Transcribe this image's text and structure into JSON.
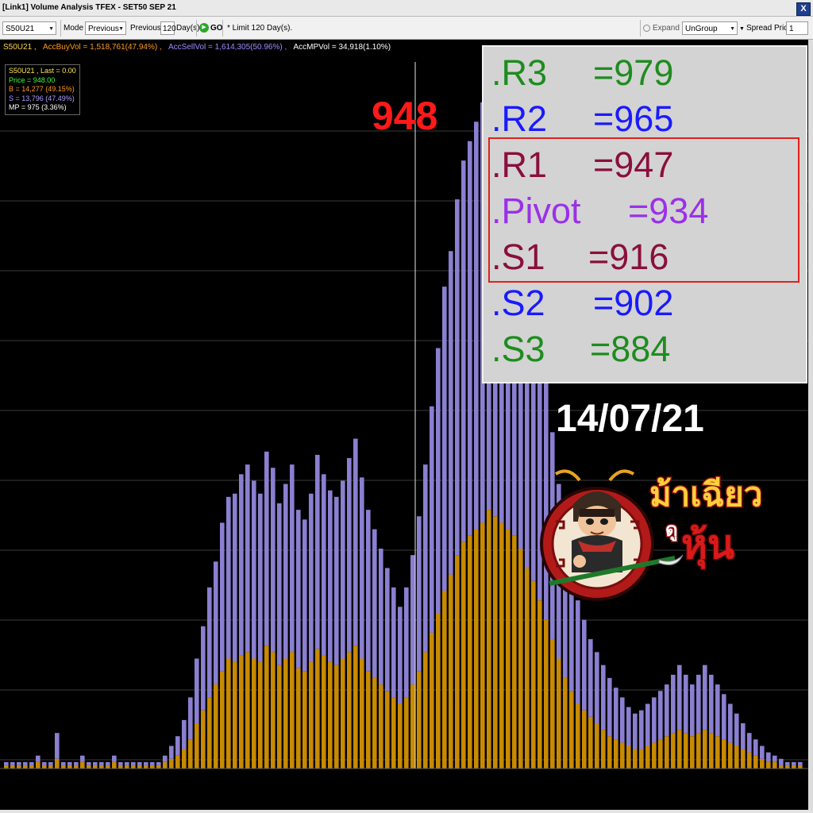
{
  "window": {
    "title": "[Link1] Volume Analysis TFEX - SET50 SEP 21",
    "close_label": "X"
  },
  "toolbar": {
    "symbol": "S50U21",
    "mode_label": "Mode :",
    "mode_value": "Previous",
    "previous_label": "Previous :",
    "previous_value": "120",
    "days_label": "Day(s)",
    "go_label": "GO",
    "limit_note": "* Limit 120 Day(s).",
    "expand_label": "Expand",
    "group_value": "UnGroup",
    "spread_label": "Spread Price :",
    "spread_value": "1"
  },
  "summary": {
    "symbol_text": "S50U21 ,",
    "acc_buy": "AccBuyVol = 1,518,761(47.94%) ,",
    "acc_sell": "AccSellVol = 1,614,305(50.96%) ,",
    "acc_mp": "AccMPVol = 34,918(1.10%)"
  },
  "infobox": {
    "line1": "S50U21 , Last = 0.00",
    "line2": "Price = 948.00",
    "line3": "B = 14,277 (49.15%)",
    "line4": "S = 13,796 (47.49%)",
    "line5": "MP = 975 (3.36%)"
  },
  "overlay": {
    "price_callout": "948",
    "date": "14/07/21",
    "levels": [
      {
        "name": ".R3",
        "value": "=979",
        "color": "#1e8c1e"
      },
      {
        "name": ".R2",
        "value": "=965",
        "color": "#1a1aff"
      },
      {
        "name": ".R1",
        "value": "=947",
        "color": "#8a0f3c"
      },
      {
        "name": ".Pivot",
        "value": "=934",
        "color": "#9b30e8"
      },
      {
        "name": ".S1",
        "value": "=916",
        "color": "#8a0f3c"
      },
      {
        "name": ".S2",
        "value": "=902",
        "color": "#1a1aff"
      },
      {
        "name": ".S3",
        "value": "=884",
        "color": "#1e8c1e"
      }
    ],
    "logo_text_top": "ม้าเฉียว",
    "logo_text_sub": "ดู",
    "logo_text_bottom": "หุ้น"
  },
  "colors": {
    "buy": "#c88a00",
    "sell": "#8a7fd0",
    "summary_symbol": "#ffd54a",
    "summary_buy": "#ff9a1e",
    "summary_sell": "#9d8cff",
    "summary_mp": "#ffffff"
  },
  "chart_data": {
    "type": "bar",
    "stacked": true,
    "series": [
      {
        "name": "B",
        "values": [
          1,
          1,
          1,
          1,
          1,
          2,
          1,
          1,
          3,
          1,
          1,
          1,
          2,
          1,
          1,
          1,
          1,
          2,
          1,
          1,
          1,
          1,
          1,
          1,
          1,
          2,
          3,
          4,
          6,
          9,
          14,
          18,
          22,
          26,
          30,
          34,
          33,
          35,
          36,
          34,
          33,
          38,
          36,
          32,
          34,
          36,
          31,
          30,
          33,
          37,
          35,
          33,
          32,
          34,
          36,
          38,
          34,
          30,
          28,
          26,
          24,
          22,
          20,
          22,
          26,
          30,
          36,
          42,
          48,
          55,
          60,
          66,
          70,
          72,
          74,
          76,
          80,
          78,
          76,
          74,
          72,
          68,
          62,
          58,
          52,
          46,
          40,
          34,
          28,
          24,
          20,
          18,
          16,
          14,
          12,
          10,
          9,
          8,
          7,
          6,
          6,
          7,
          8,
          9,
          10,
          11,
          12,
          11,
          10,
          11,
          12,
          11,
          10,
          9,
          8,
          7,
          6,
          5,
          4,
          3,
          2,
          2,
          1,
          1,
          1,
          1
        ]
      },
      {
        "name": "S",
        "values": [
          1,
          1,
          1,
          1,
          1,
          2,
          1,
          1,
          8,
          1,
          1,
          1,
          2,
          1,
          1,
          1,
          1,
          2,
          1,
          1,
          1,
          1,
          1,
          1,
          1,
          2,
          4,
          6,
          9,
          13,
          20,
          26,
          34,
          38,
          46,
          50,
          52,
          56,
          58,
          55,
          52,
          60,
          57,
          50,
          54,
          58,
          49,
          47,
          52,
          60,
          56,
          53,
          52,
          55,
          60,
          64,
          56,
          50,
          46,
          42,
          38,
          34,
          30,
          34,
          40,
          48,
          58,
          70,
          82,
          94,
          100,
          110,
          118,
          122,
          126,
          130,
          138,
          132,
          126,
          122,
          118,
          112,
          102,
          94,
          84,
          74,
          64,
          54,
          44,
          38,
          32,
          28,
          24,
          22,
          20,
          18,
          16,
          14,
          12,
          11,
          12,
          13,
          14,
          15,
          16,
          18,
          20,
          18,
          16,
          18,
          20,
          18,
          16,
          14,
          12,
          10,
          8,
          6,
          5,
          4,
          3,
          2,
          2,
          1,
          1,
          1
        ]
      }
    ]
  }
}
